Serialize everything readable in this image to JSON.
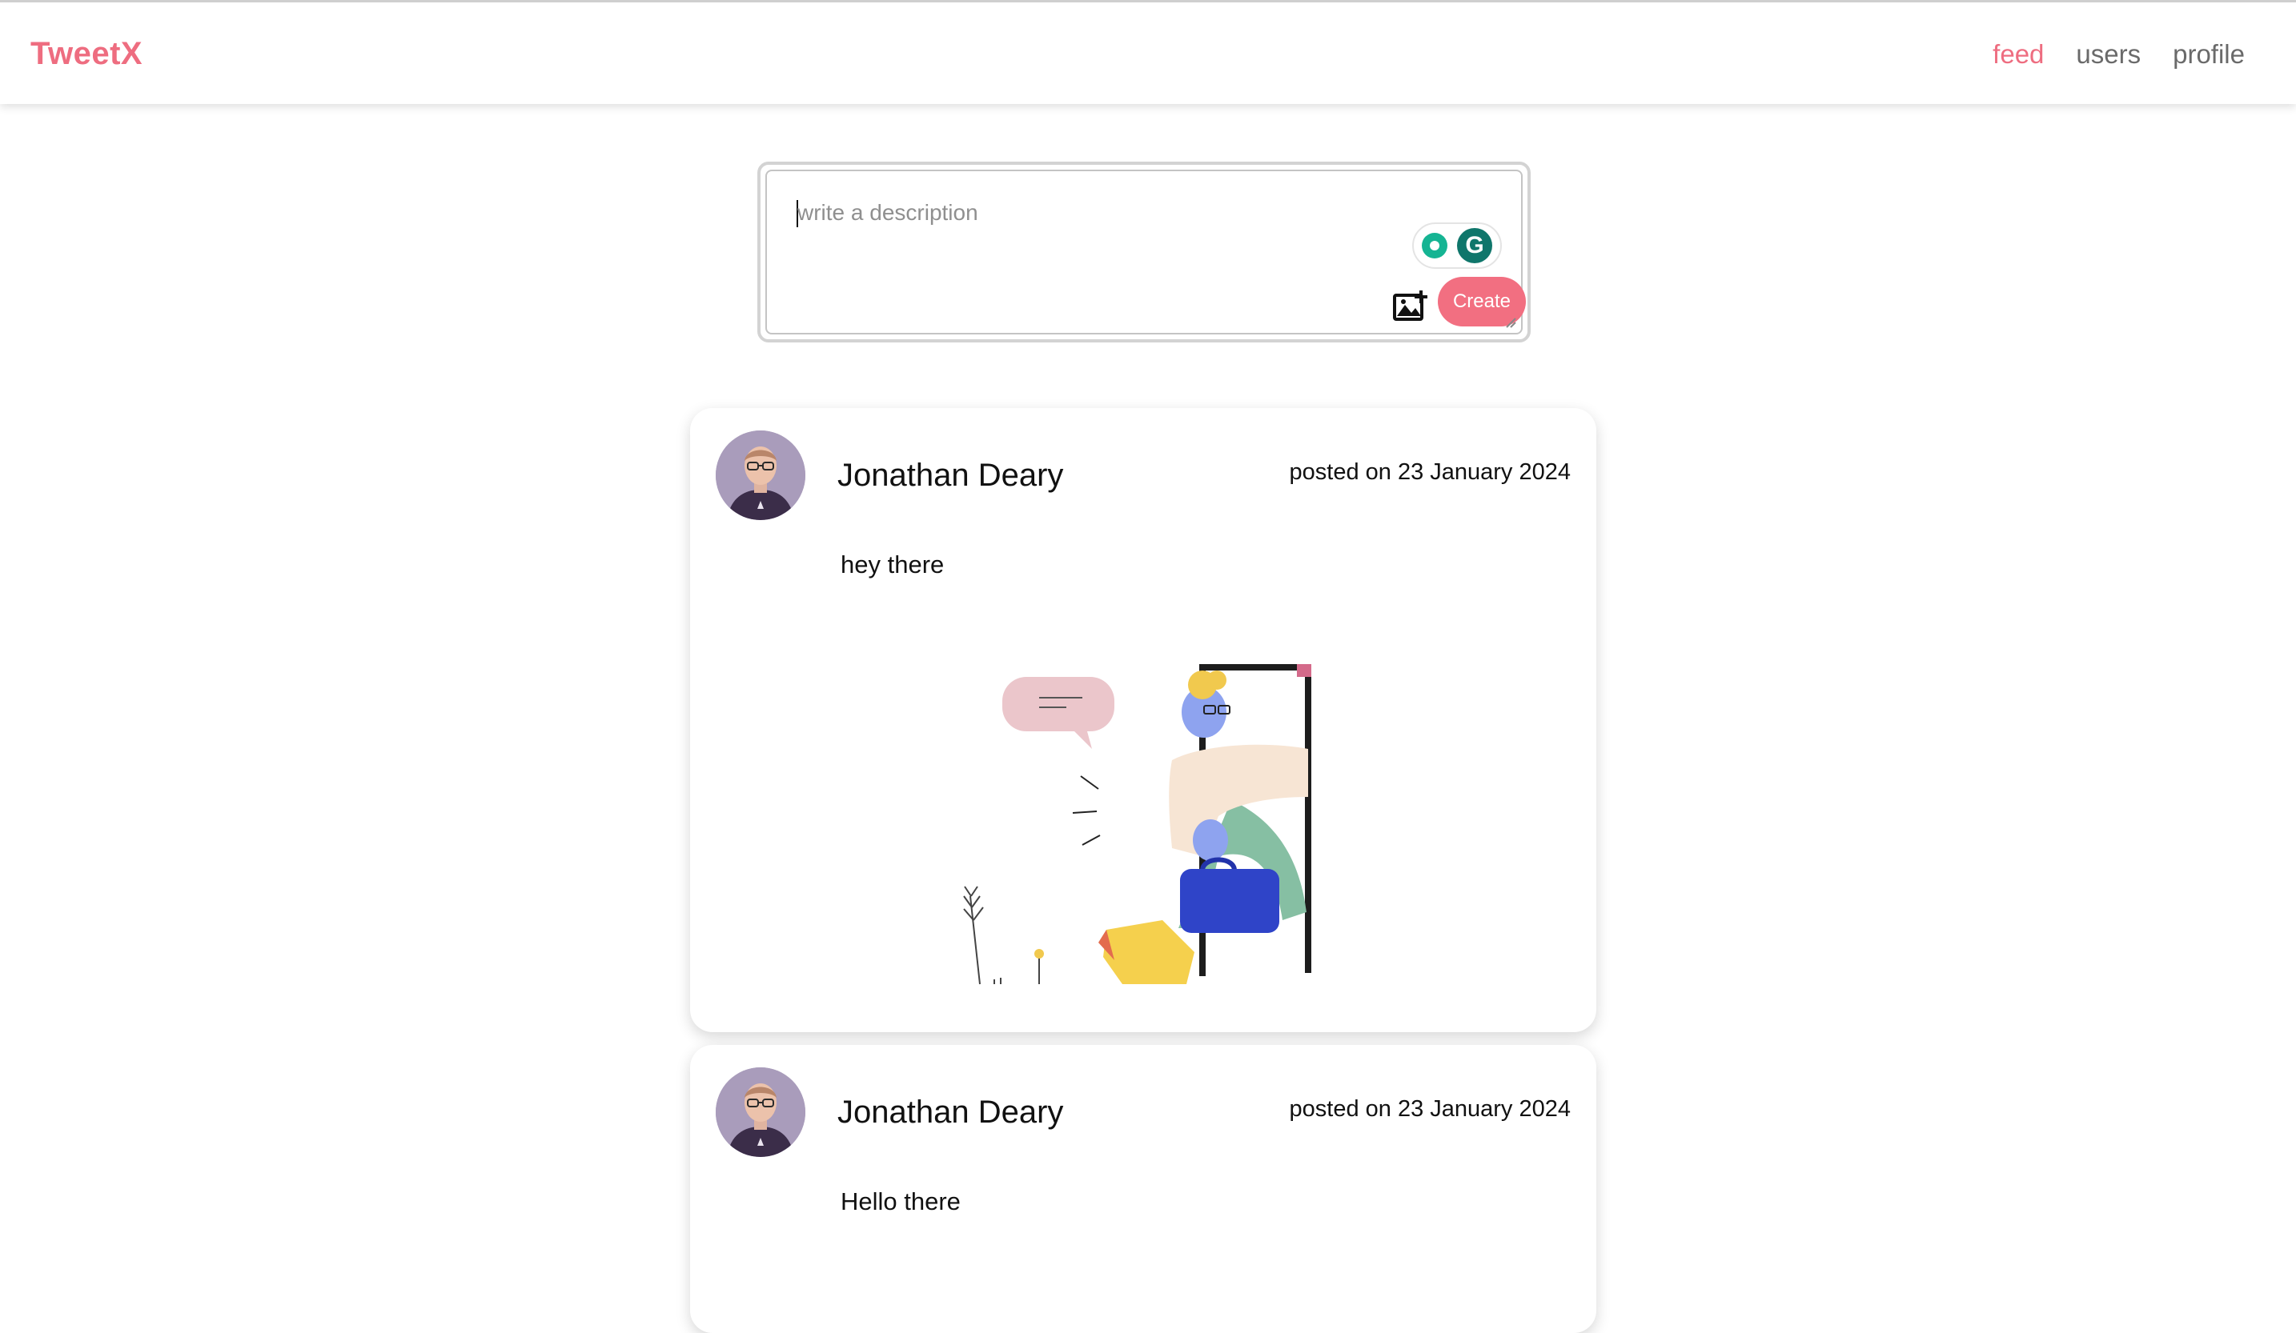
{
  "app": {
    "brand": "TweetX"
  },
  "nav": [
    {
      "label": "feed",
      "active": true
    },
    {
      "label": "users",
      "active": false
    },
    {
      "label": "profile",
      "active": false
    }
  ],
  "composer": {
    "placeholder": "write a description",
    "value": "",
    "create_label": "Create",
    "image_button_icon": "add-image-icon",
    "grammarly_icons": [
      "lightbulb-icon",
      "grammarly-g-icon"
    ]
  },
  "posts": [
    {
      "author": "Jonathan Deary",
      "date": "posted on 23 January 2024",
      "text": "hey there",
      "has_image": true,
      "image_icon": "person-leaving-door-illustration"
    },
    {
      "author": "Jonathan Deary",
      "date": "posted on 23 January 2024",
      "text": "Hello there",
      "has_image": false
    }
  ],
  "colors": {
    "accent": "#ee6d80",
    "create_button": "#f26f81",
    "nav_inactive": "#6a6a6a",
    "grammarly_green": "#0f766b"
  }
}
